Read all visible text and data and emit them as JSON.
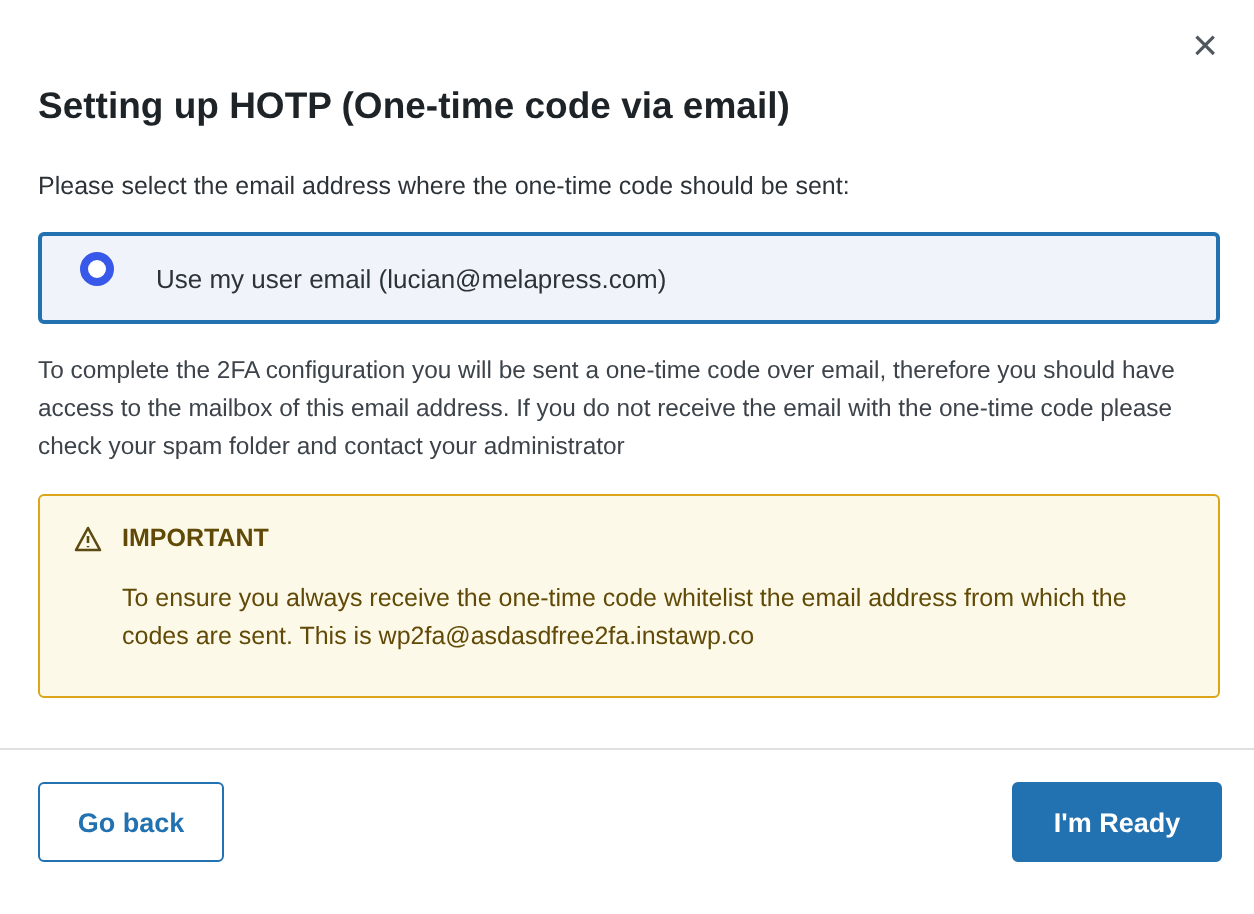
{
  "dialog": {
    "title": "Setting up HOTP (One-time code via email)",
    "close": "×"
  },
  "prompt": "Please select the email address where the one-time code should be sent:",
  "options": [
    {
      "label": "Use my user email (lucian@melapress.com)",
      "selected": true
    }
  ],
  "description": "To complete the 2FA configuration you will be sent a one-time code over email, therefore you should have access to the mailbox of this email address. If you do not receive the email with the one-time code please check your spam folder and contact your administrator",
  "notice": {
    "heading": "IMPORTANT",
    "text": "To ensure you always receive the one-time code whitelist the email address from which the codes are sent. This is wp2fa@asdasdfree2fa.instawp.co"
  },
  "buttons": [
    {
      "label": "Go back",
      "kind": "secondary"
    },
    {
      "label": "I'm Ready",
      "kind": "primary"
    }
  ]
}
